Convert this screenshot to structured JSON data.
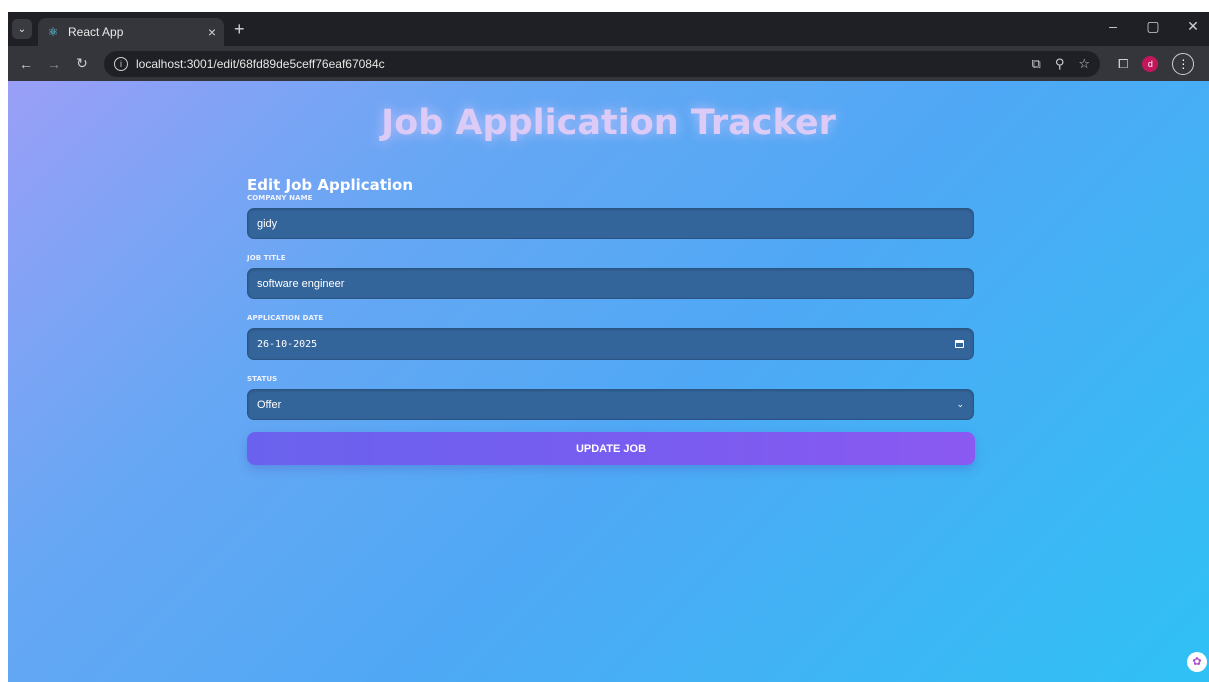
{
  "browser": {
    "tab_title": "React App",
    "url": "localhost:3001/edit/68fd89de5ceff76eaf67084c",
    "avatar_letter": "d"
  },
  "app": {
    "title": "Job Application Tracker"
  },
  "form": {
    "heading": "Edit Job Application",
    "company_label": "COMPANY NAME",
    "company_value": "gidy",
    "job_title_label": "JOB TITLE",
    "job_title_value": "software engineer",
    "date_label": "APPLICATION DATE",
    "date_value": "26-10-2025",
    "status_label": "STATUS",
    "status_value": "Offer",
    "submit_label": "UPDATE JOB"
  },
  "colors": {
    "accent": "#7a5cf0",
    "input_bg": "#33649a"
  }
}
